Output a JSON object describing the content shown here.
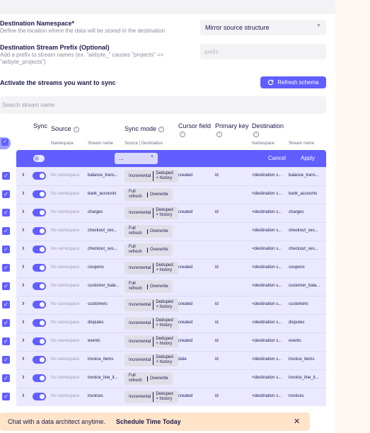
{
  "destination_namespace": {
    "label": "Destination Namespace*",
    "description": "Define the location where the data will be stored in the destination",
    "value": "Mirror source structure"
  },
  "stream_prefix": {
    "label": "Destination Stream Prefix (Optional)",
    "description_line1": "Add a prefix to stream names (ex. \"airbyte_\" causes \"projects\" =>",
    "description_line2": "\"airbyte_projects\")",
    "placeholder": "prefix"
  },
  "streams": {
    "heading": "Activate the streams you want to sync",
    "refresh_label": "Refresh schema",
    "search_placeholder": "Search stream name"
  },
  "columns": {
    "sync": "Sync",
    "source": "Source",
    "sync_mode": "Sync mode",
    "cursor_field": "Cursor field",
    "primary_key": "Primary key",
    "destination": "Destination",
    "sub_namespace": "Namespace",
    "sub_stream_name": "Stream name",
    "sub_source_dest": "Source | Destination",
    "sub_dest_namespace": "Namespace",
    "sub_dest_stream": "Stream name"
  },
  "bulk": {
    "dropdown_value": "...",
    "cancel": "Cancel",
    "apply": "Apply"
  },
  "rows": [
    {
      "ns": "No namespace",
      "name": "balance_trans...",
      "mode_a": "Incremental",
      "mode_b": "Deduped + history",
      "cursor": "created",
      "pk": "id",
      "dest_ns": "<destination s...",
      "dest_name": "balance_trans..."
    },
    {
      "ns": "No namespace",
      "name": "bank_accounts",
      "mode_a": "Full refresh",
      "mode_b": "Overwrite",
      "cursor": "",
      "pk": "",
      "dest_ns": "<destination s...",
      "dest_name": "bank_accounts"
    },
    {
      "ns": "No namespace",
      "name": "charges",
      "mode_a": "Incremental",
      "mode_b": "Deduped + history",
      "cursor": "created",
      "pk": "id",
      "dest_ns": "<destination s...",
      "dest_name": "charges"
    },
    {
      "ns": "No namespace",
      "name": "checkout_ses...",
      "mode_a": "Full refresh",
      "mode_b": "Overwrite",
      "cursor": "",
      "pk": "",
      "dest_ns": "<destination s...",
      "dest_name": "checkout_ses..."
    },
    {
      "ns": "No namespace",
      "name": "checkout_ses...",
      "mode_a": "Full refresh",
      "mode_b": "Overwrite",
      "cursor": "",
      "pk": "",
      "dest_ns": "<destination s...",
      "dest_name": "checkout_ses..."
    },
    {
      "ns": "No namespace",
      "name": "coupons",
      "mode_a": "Incremental",
      "mode_b": "Deduped + history",
      "cursor": "created",
      "pk": "id",
      "dest_ns": "<destination s...",
      "dest_name": "coupons"
    },
    {
      "ns": "No namespace",
      "name": "customer_bala...",
      "mode_a": "Full refresh",
      "mode_b": "Overwrite",
      "cursor": "",
      "pk": "",
      "dest_ns": "<destination s...",
      "dest_name": "customer_bala..."
    },
    {
      "ns": "No namespace",
      "name": "customers",
      "mode_a": "Incremental",
      "mode_b": "Deduped + history",
      "cursor": "created",
      "pk": "id",
      "dest_ns": "<destination s...",
      "dest_name": "customers"
    },
    {
      "ns": "No namespace",
      "name": "disputes",
      "mode_a": "Incremental",
      "mode_b": "Deduped + history",
      "cursor": "created",
      "pk": "id",
      "dest_ns": "<destination s...",
      "dest_name": "disputes"
    },
    {
      "ns": "No namespace",
      "name": "events",
      "mode_a": "Incremental",
      "mode_b": "Deduped + history",
      "cursor": "created",
      "pk": "id",
      "dest_ns": "<destination s...",
      "dest_name": "events"
    },
    {
      "ns": "No namespace",
      "name": "invoice_items",
      "mode_a": "Incremental",
      "mode_b": "Deduped + history",
      "cursor": "date",
      "pk": "id",
      "dest_ns": "<destination s...",
      "dest_name": "invoice_items"
    },
    {
      "ns": "No namespace",
      "name": "invoice_line_it...",
      "mode_a": "Full refresh",
      "mode_b": "Overwrite",
      "cursor": "",
      "pk": "",
      "dest_ns": "<destination s...",
      "dest_name": "invoice_line_it..."
    },
    {
      "ns": "No namespace",
      "name": "invoices",
      "mode_a": "Incremental",
      "mode_b": "Deduped + history",
      "cursor": "created",
      "pk": "id",
      "dest_ns": "<destination s...",
      "dest_name": "invoices"
    }
  ],
  "toast": {
    "message": "Chat with a data architect anytime.",
    "link": "Schedule Time Today"
  },
  "colors": {
    "accent": "#615eff",
    "row_bg": "#eae9ff",
    "toast_bg": "#ffe4c9"
  }
}
